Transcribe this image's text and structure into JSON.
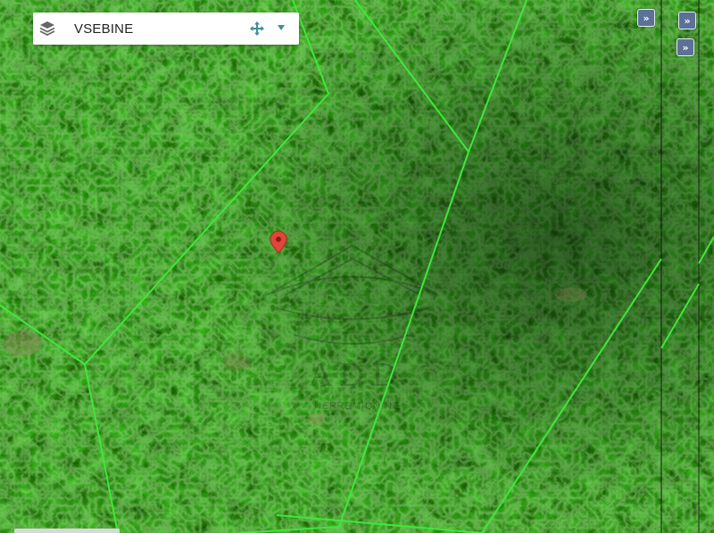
{
  "layers_panel": {
    "title": "VSEBINE",
    "layers_icon": "layers-icon",
    "move_icon": "move-arrows-icon",
    "caret_icon": "caret-down-icon"
  },
  "side_buttons": [
    {
      "label": "»",
      "icon": "double-chevron-right-icon"
    },
    {
      "label": "»",
      "icon": "double-chevron-right-icon"
    },
    {
      "label": "»",
      "icon": "double-chevron-right-icon"
    }
  ],
  "map": {
    "type": "aerial orthophoto forest",
    "parcel_line_color": "#3ee83a",
    "marker_color": "#e0463a",
    "watermark_text": "A D D",
    "watermark_subtext": "NEPREMIČNINE"
  }
}
